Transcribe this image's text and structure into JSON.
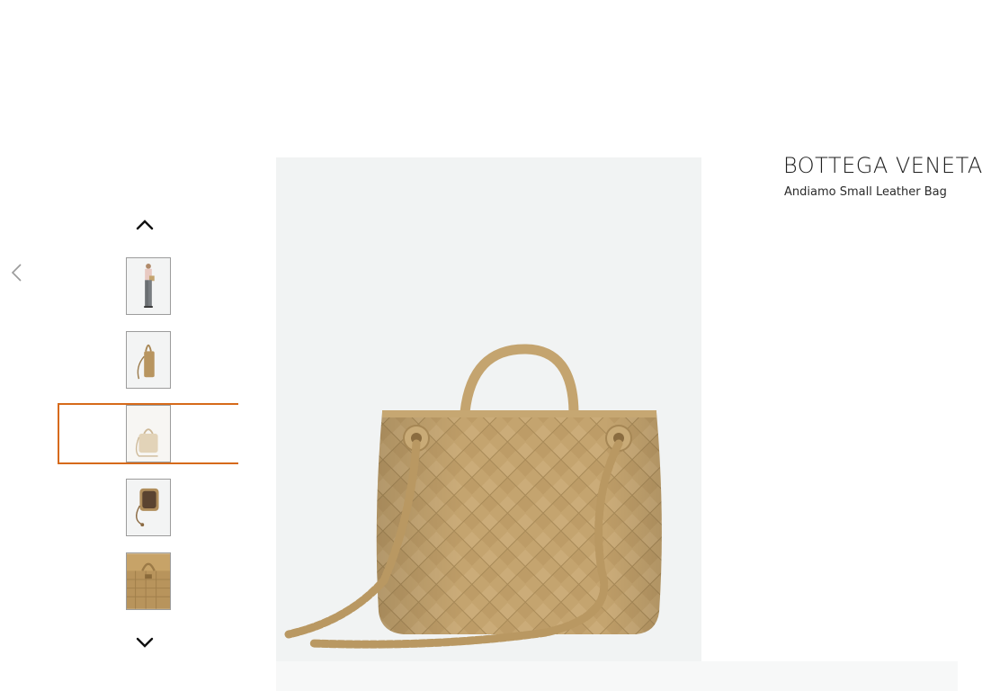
{
  "product": {
    "brand": "BOTTEGA VENETA",
    "name": "Andiamo Small Leather Bag"
  },
  "gallery": {
    "thumbnails": [
      {
        "subject": "model wearing bag"
      },
      {
        "subject": "bag side view"
      },
      {
        "subject": "bag front view",
        "selected": true
      },
      {
        "subject": "bag open interior"
      },
      {
        "subject": "bag top detail"
      }
    ],
    "main_image_subject": "woven leather bag with braided straps"
  },
  "icons": {
    "prev": "chevron-left-icon",
    "thumb_up": "chevron-up-icon",
    "thumb_down": "chevron-down-icon"
  },
  "colors": {
    "accent": "#d66a1a",
    "bag": "#c4a46f",
    "background_panel": "#f1f3f3"
  }
}
